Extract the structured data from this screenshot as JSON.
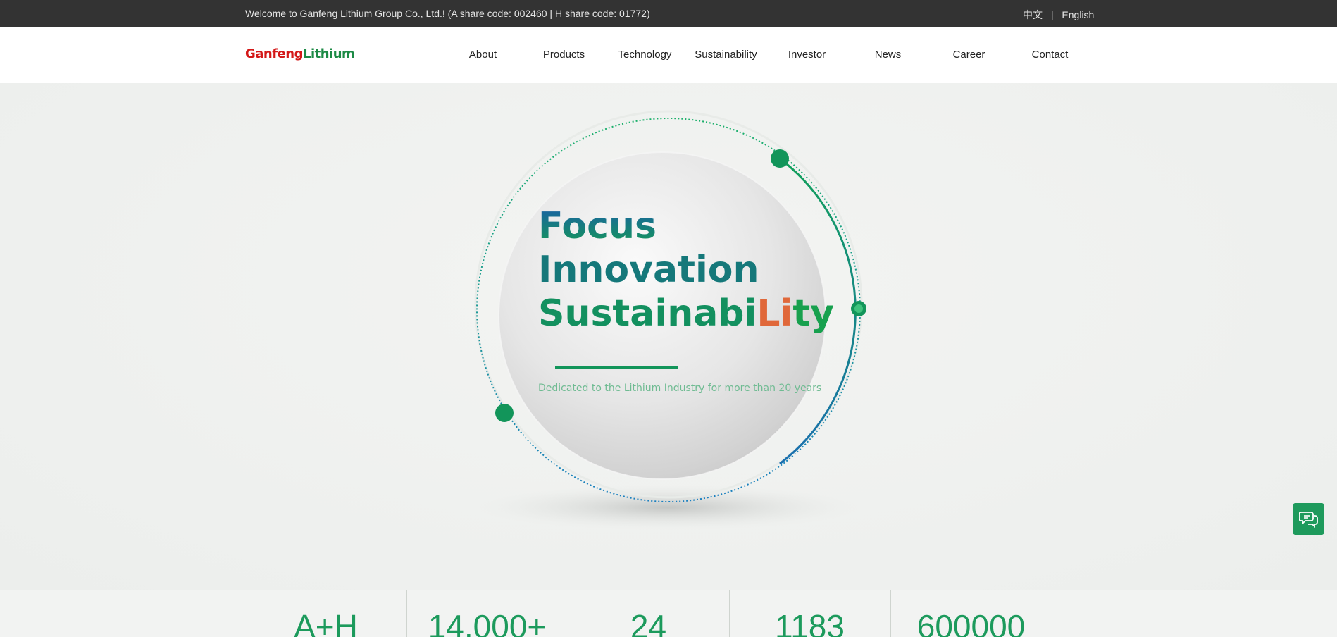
{
  "topbar": {
    "welcome": "Welcome to Ganfeng Lithium Group Co., Ltd.!  (A share code: 002460 | H share code: 01772)",
    "lang_zh": "中文",
    "lang_sep": "|",
    "lang_en": "English"
  },
  "header": {
    "logo_part1": "Ganfeng",
    "logo_part2": "Lithium",
    "nav": [
      "About",
      "Products",
      "Technology",
      "Sustainability",
      "Investor",
      "News",
      "Career",
      "Contact"
    ]
  },
  "hero": {
    "line1": "Focus",
    "line2": "Innovation",
    "line3_a": "Sustainabi",
    "line3_b": "Li",
    "line3_c": "ty",
    "subtitle": "Dedicated to the Lithium Industry for more than 20 years",
    "colors": {
      "blue": "#1a5fa0",
      "green": "#12955a",
      "orange": "#e0683a",
      "ring": "#13a05c"
    }
  },
  "stats": [
    "A+H",
    "14,000+",
    "24",
    "1183",
    "600000"
  ],
  "chat": {
    "icon": "chat-bubbles-icon"
  },
  "colors": {
    "topbar_bg": "#333333",
    "accent": "#1e9a5c",
    "logo_red": "#d41818"
  }
}
